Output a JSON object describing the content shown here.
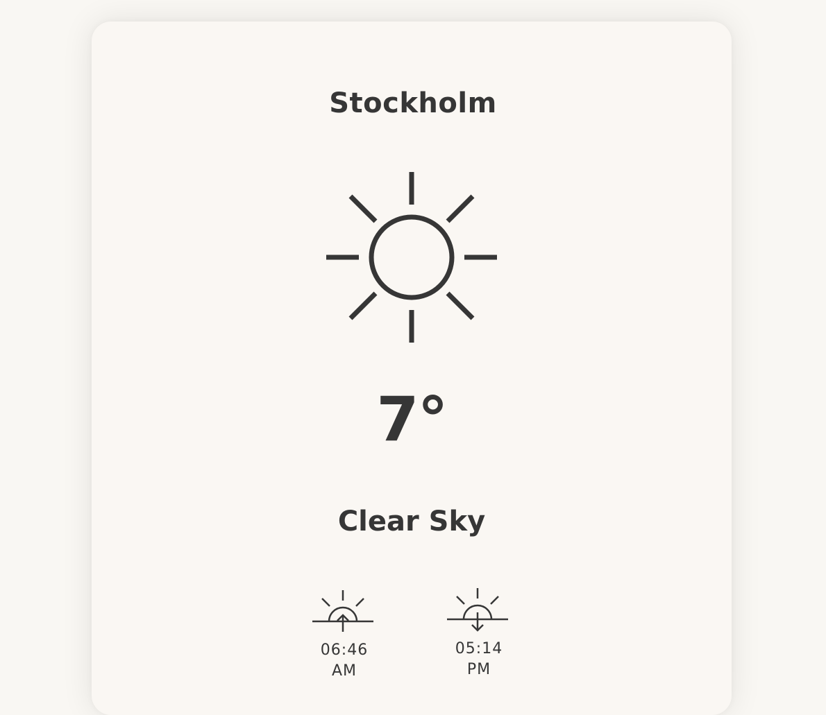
{
  "location": {
    "city": "Stockholm"
  },
  "current": {
    "icon": "sun-icon",
    "temperature": "7°",
    "condition": "Clear Sky"
  },
  "sun": {
    "sunrise": {
      "icon": "sunrise-icon",
      "time": "06:46",
      "period": "AM"
    },
    "sunset": {
      "icon": "sunset-icon",
      "time": "05:14",
      "period": "PM"
    }
  },
  "colors": {
    "background": "#f9f7f3",
    "card": "#faf7f3",
    "text": "#363636"
  }
}
